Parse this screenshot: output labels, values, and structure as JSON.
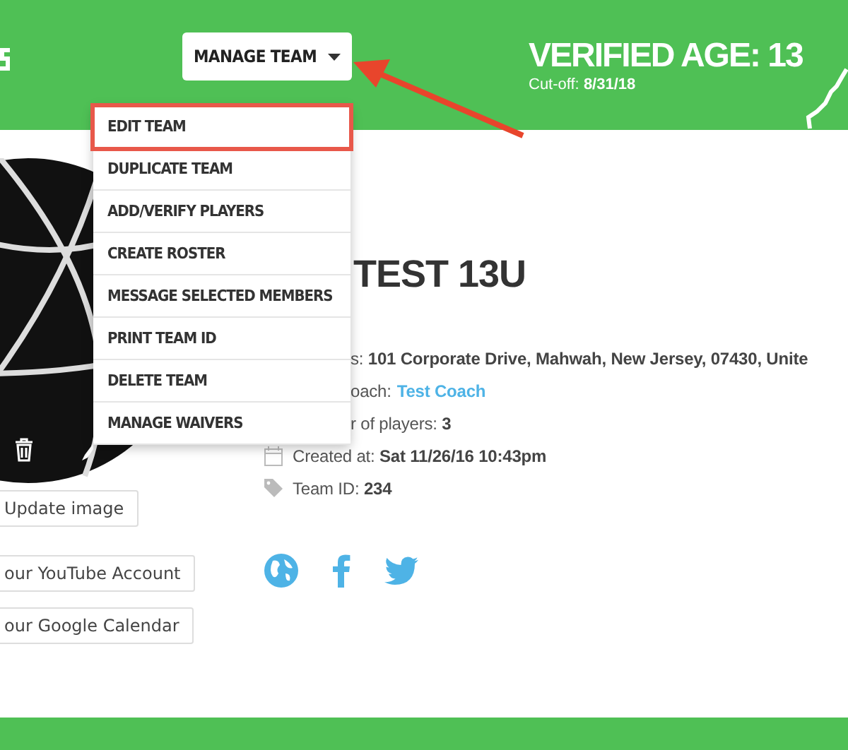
{
  "header": {
    "manage_button": {
      "label": "MANAGE TEAM"
    },
    "verified_age": "VERIFIED AGE: 13",
    "cutoff_label": "Cut-off:",
    "cutoff_value": "8/31/18"
  },
  "menu": {
    "items": [
      {
        "label": "EDIT TEAM",
        "selected": true
      },
      {
        "label": "DUPLICATE TEAM",
        "selected": false
      },
      {
        "label": "ADD/VERIFY PLAYERS",
        "selected": false
      },
      {
        "label": "CREATE ROSTER",
        "selected": false
      },
      {
        "label": "MESSAGE SELECTED MEMBERS",
        "selected": false
      },
      {
        "label": "PRINT TEAM ID",
        "selected": false
      },
      {
        "label": "DELETE TEAM",
        "selected": false
      },
      {
        "label": "MANAGE WAIVERS",
        "selected": false
      }
    ]
  },
  "team": {
    "name": "TEST 13U",
    "details": [
      {
        "kind": "address",
        "text": "s: **101 Corporate Drive, Mahwah, New Jersey, 07430, Unite**"
      },
      {
        "kind": "coach",
        "text": "oach:",
        "link": "Test Coach"
      },
      {
        "kind": "players",
        "text": "r of players: **3**"
      },
      {
        "kind": "created",
        "text": "Created at: **Sat 11/26/16 10:43pm**"
      },
      {
        "kind": "team_id",
        "text": "Team ID: **234**"
      }
    ]
  },
  "buttons": [
    "Update image",
    "our YouTube Account",
    "our Google Calendar"
  ]
}
